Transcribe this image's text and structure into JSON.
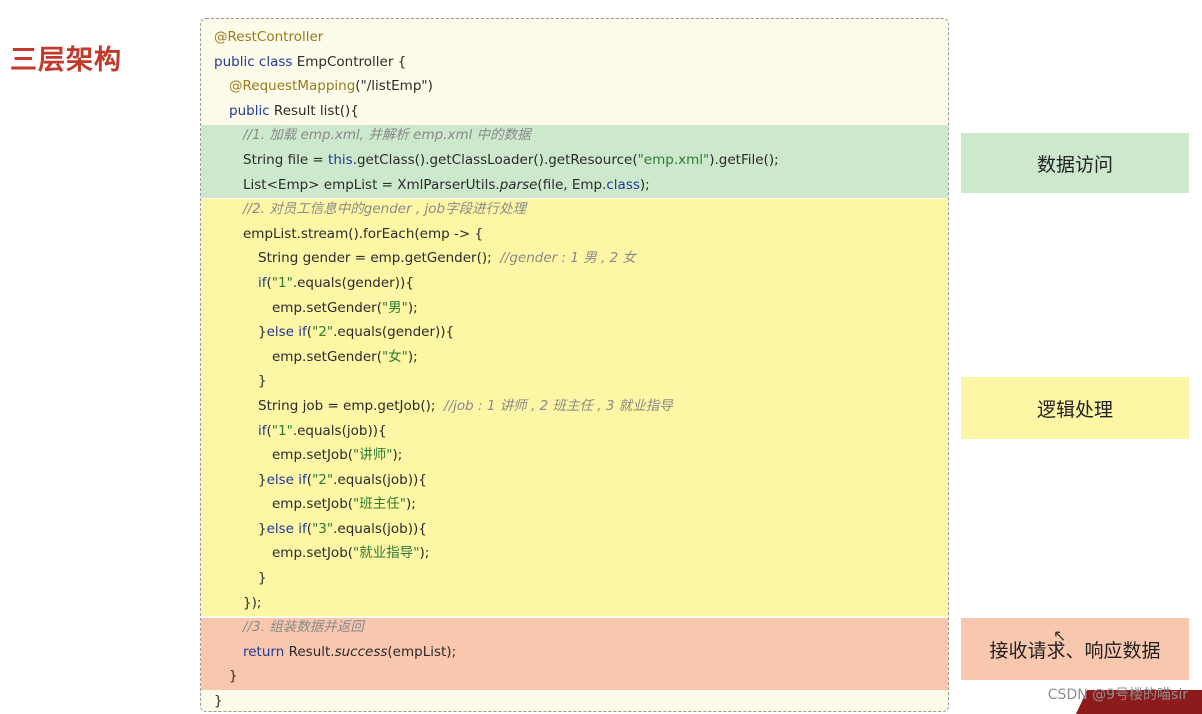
{
  "slide_title": "三层架构",
  "code_lines": [
    [
      {
        "t": "@RestController",
        "c": "ann"
      }
    ],
    [
      {
        "t": "public class ",
        "c": "kw"
      },
      {
        "t": "EmpController {",
        "c": ""
      }
    ],
    [
      {
        "t": "@RequestMapping",
        "c": "ann"
      },
      {
        "t": "(\"/listEmp\")",
        "c": ""
      }
    ],
    [
      {
        "t": "public ",
        "c": "kw"
      },
      {
        "t": "Result list(){",
        "c": ""
      }
    ],
    [
      {
        "t": "//1. 加载 emp.xml, 并解析 emp.xml 中的数据",
        "c": "cmt"
      }
    ],
    [
      {
        "t": "String file = ",
        "c": ""
      },
      {
        "t": "this",
        "c": "kw"
      },
      {
        "t": ".getClass().getClassLoader().getResource(",
        "c": ""
      },
      {
        "t": "\"emp.xml\"",
        "c": "str"
      },
      {
        "t": ").getFile();",
        "c": ""
      }
    ],
    [
      {
        "t": "List<Emp> empList = XmlParserUtils.",
        "c": ""
      },
      {
        "t": "parse",
        "c": "it"
      },
      {
        "t": "(file, Emp.",
        "c": ""
      },
      {
        "t": "class",
        "c": "kw"
      },
      {
        "t": ");",
        "c": ""
      }
    ],
    [
      {
        "t": "//2. 对员工信息中的gender , job字段进行处理",
        "c": "cmt"
      }
    ],
    [
      {
        "t": "empList.stream().forEach(emp -> {",
        "c": ""
      }
    ],
    [
      {
        "t": "String gender = emp.getGender();  ",
        "c": ""
      },
      {
        "t": "//gender : 1 男 , 2 女",
        "c": "cmt"
      }
    ],
    [
      {
        "t": "if",
        "c": "kw"
      },
      {
        "t": "(",
        "c": ""
      },
      {
        "t": "\"1\"",
        "c": "str"
      },
      {
        "t": ".equals(gender)){",
        "c": ""
      }
    ],
    [
      {
        "t": "emp.setGender(",
        "c": ""
      },
      {
        "t": "\"男\"",
        "c": "str"
      },
      {
        "t": ");",
        "c": ""
      }
    ],
    [
      {
        "t": "}",
        "c": ""
      },
      {
        "t": "else if",
        "c": "kw"
      },
      {
        "t": "(",
        "c": ""
      },
      {
        "t": "\"2\"",
        "c": "str"
      },
      {
        "t": ".equals(gender)){",
        "c": ""
      }
    ],
    [
      {
        "t": "emp.setGender(",
        "c": ""
      },
      {
        "t": "\"女\"",
        "c": "str"
      },
      {
        "t": ");",
        "c": ""
      }
    ],
    [
      {
        "t": "}",
        "c": ""
      }
    ],
    [
      {
        "t": "String job = emp.getJob();  ",
        "c": ""
      },
      {
        "t": "//job : 1 讲师 , 2 班主任 , 3 就业指导",
        "c": "cmt"
      }
    ],
    [
      {
        "t": "if",
        "c": "kw"
      },
      {
        "t": "(",
        "c": ""
      },
      {
        "t": "\"1\"",
        "c": "str"
      },
      {
        "t": ".equals(job)){",
        "c": ""
      }
    ],
    [
      {
        "t": "emp.setJob(",
        "c": ""
      },
      {
        "t": "\"讲师\"",
        "c": "str"
      },
      {
        "t": ");",
        "c": ""
      }
    ],
    [
      {
        "t": "}",
        "c": ""
      },
      {
        "t": "else if",
        "c": "kw"
      },
      {
        "t": "(",
        "c": ""
      },
      {
        "t": "\"2\"",
        "c": "str"
      },
      {
        "t": ".equals(job)){",
        "c": ""
      }
    ],
    [
      {
        "t": "emp.setJob(",
        "c": ""
      },
      {
        "t": "\"班主任\"",
        "c": "str"
      },
      {
        "t": ");",
        "c": ""
      }
    ],
    [
      {
        "t": "}",
        "c": ""
      },
      {
        "t": "else if",
        "c": "kw"
      },
      {
        "t": "(",
        "c": ""
      },
      {
        "t": "\"3\"",
        "c": "str"
      },
      {
        "t": ".equals(job)){",
        "c": ""
      }
    ],
    [
      {
        "t": "emp.setJob(",
        "c": ""
      },
      {
        "t": "\"就业指导\"",
        "c": "str"
      },
      {
        "t": ");",
        "c": ""
      }
    ],
    [
      {
        "t": "}",
        "c": ""
      }
    ],
    [
      {
        "t": "});",
        "c": ""
      }
    ],
    [
      {
        "t": "//3. 组装数据并返回",
        "c": "cmt"
      }
    ],
    [
      {
        "t": "return ",
        "c": "kw"
      },
      {
        "t": "Result.",
        "c": ""
      },
      {
        "t": "success",
        "c": "it"
      },
      {
        "t": "(empList);",
        "c": ""
      }
    ],
    [
      {
        "t": "}",
        "c": ""
      }
    ],
    [
      {
        "t": "}",
        "c": ""
      }
    ]
  ],
  "labels": {
    "data_access": "数据访问",
    "logic": "逻辑处理",
    "accept": "接收请求、响应数据"
  },
  "watermark": "CSDN @9号楼的喵sir"
}
